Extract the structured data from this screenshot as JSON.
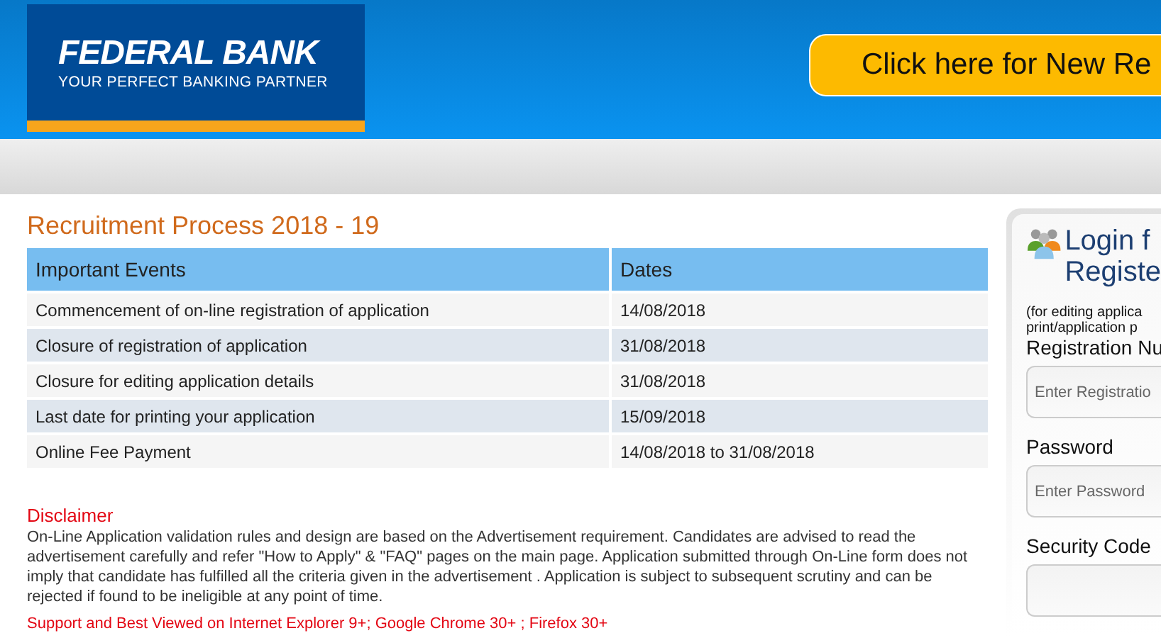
{
  "header": {
    "logo": {
      "name": "FEDERAL BANK",
      "tagline": "YOUR PERFECT BANKING PARTNER"
    },
    "cta_button": "Click here for New Re"
  },
  "recruitment": {
    "title": "Recruitment Process 2018 - 19",
    "table": {
      "columns": [
        "Important Events",
        "Dates"
      ],
      "rows": [
        [
          "Commencement of on-line registration of application",
          "14/08/2018"
        ],
        [
          "Closure of registration of application",
          "31/08/2018"
        ],
        [
          "Closure for editing application details",
          "31/08/2018"
        ],
        [
          "Last date for printing your application",
          "15/09/2018"
        ],
        [
          "Online Fee Payment",
          "14/08/2018 to 31/08/2018"
        ]
      ]
    },
    "disclaimer": {
      "title": "Disclaimer",
      "text": "On-Line Application validation rules and design are based on the Advertisement requirement. Candidates are advised to read the advertisement carefully and refer \"How to Apply\" & \"FAQ\" pages on the main page. Application submitted through On-Line form does not imply that candidate has fulfilled all the criteria given in the advertisement . Application is subject to subsequent scrutiny and can be rejected if found to be ineligible at any point of time."
    },
    "support_note": "Support and Best Viewed on Internet Explorer 9+; Google Chrome 30+ ; Firefox 30+"
  },
  "login_panel": {
    "title_lines": [
      "Login f",
      "Registe"
    ],
    "note_lines": [
      "(for editing applica",
      "print/application p"
    ],
    "fields": [
      {
        "label": "Registration Nu",
        "placeholder": "Enter Registratio"
      },
      {
        "label": "Password",
        "placeholder": "Enter Password"
      },
      {
        "label": "Security Code"
      }
    ]
  }
}
